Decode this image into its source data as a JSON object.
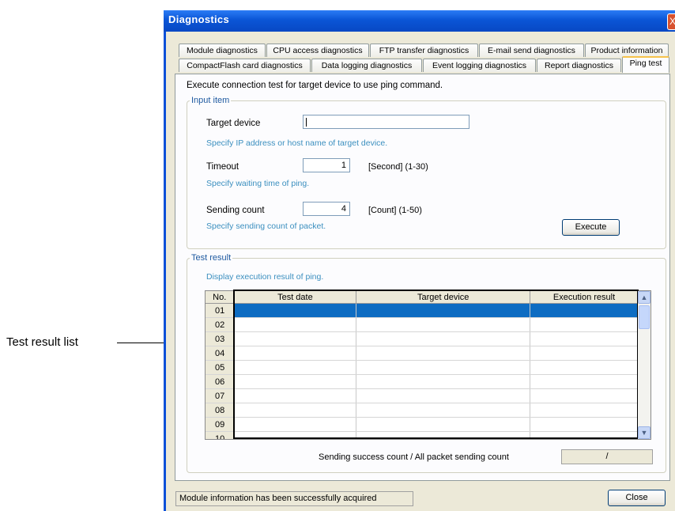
{
  "callout": {
    "label": "Test result list"
  },
  "window": {
    "title": "Diagnostics",
    "close_glyph": "X"
  },
  "tabs_row1": [
    "Module diagnostics",
    "CPU access diagnostics",
    "FTP transfer diagnostics",
    "E-mail send diagnostics",
    "Product information"
  ],
  "tabs_row2": [
    "CompactFlash card diagnostics",
    "Data logging diagnostics",
    "Event logging diagnostics",
    "Report diagnostics",
    "Ping test"
  ],
  "active_tab": "Ping test",
  "panel": {
    "description": "Execute connection test for target device to use ping command.",
    "input_group": {
      "title": "Input item",
      "target_label": "Target device",
      "target_value": "",
      "target_hint": "Specify IP address or host name of target device.",
      "timeout_label": "Timeout",
      "timeout_value": "1",
      "timeout_unit": "[Second] (1-30)",
      "timeout_hint": "Specify waiting time of ping.",
      "count_label": "Sending count",
      "count_value": "4",
      "count_unit": "[Count] (1-50)",
      "count_hint": "Specify sending count of packet.",
      "execute_label": "Execute"
    },
    "result_group": {
      "title": "Test result",
      "hint": "Display execution result of ping.",
      "columns": [
        "No.",
        "Test date",
        "Target device",
        "Execution result"
      ],
      "rows": [
        "01",
        "02",
        "03",
        "04",
        "05",
        "06",
        "07",
        "08",
        "09",
        "10"
      ],
      "selected_row": "01",
      "summary_label": "Sending success count / All packet sending count",
      "summary_value": "/"
    }
  },
  "status_bar": {
    "message": "Module information has been successfully acquired"
  },
  "close_label": "Close",
  "colors": {
    "title_bar": "#0a55d6",
    "selection": "#0d6cc2",
    "hint_text": "#3b8fbf"
  }
}
